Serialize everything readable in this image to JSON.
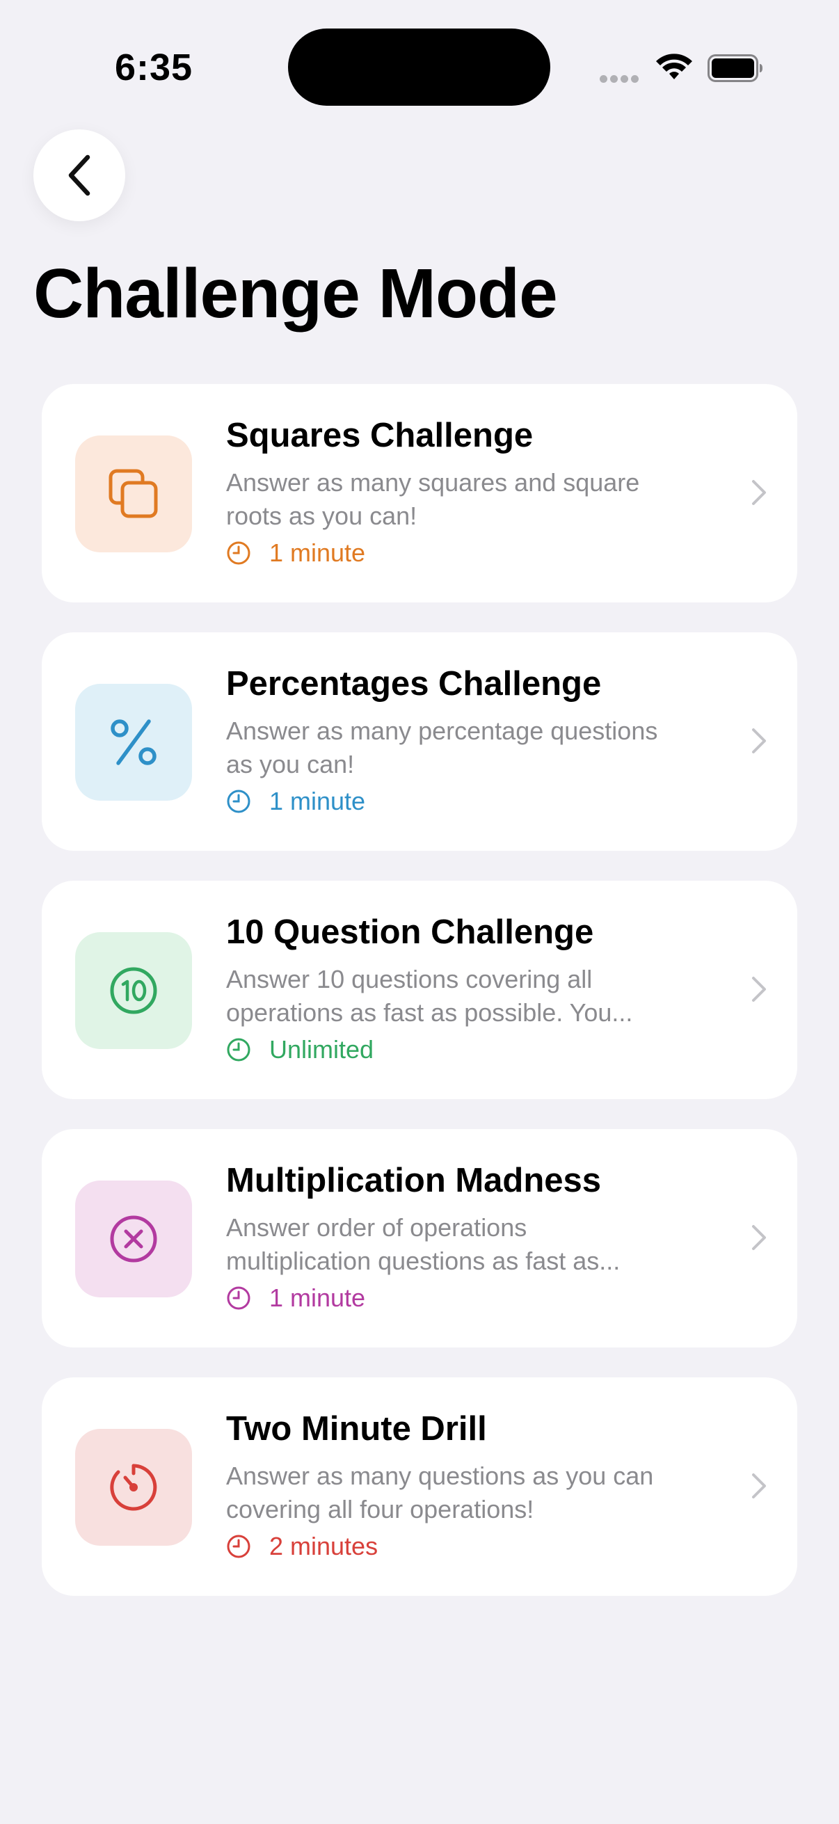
{
  "status": {
    "time": "6:35"
  },
  "nav": {
    "back_icon": "chevron-left-icon"
  },
  "page": {
    "title": "Challenge Mode"
  },
  "challenges": [
    {
      "title": "Squares Challenge",
      "description": "Answer as many squares and square roots as you can!",
      "duration": "1 minute",
      "icon": "squares-icon",
      "accent": "#e07a22",
      "tile_bg": "#fce8dc"
    },
    {
      "title": "Percentages Challenge",
      "description": "Answer as many percentage questions as you can!",
      "duration": "1 minute",
      "icon": "percent-icon",
      "accent": "#2e90c8",
      "tile_bg": "#dff0f8"
    },
    {
      "title": "10 Question Challenge",
      "description": "Answer 10 questions covering all operations as fast as possible. You...",
      "duration": "Unlimited",
      "icon": "number-ten-circle-icon",
      "accent": "#31a860",
      "tile_bg": "#e0f4e6"
    },
    {
      "title": "Multiplication Madness",
      "description": "Answer order of operations multiplication questions as fast as...",
      "duration": "1 minute",
      "icon": "multiply-circle-icon",
      "accent": "#b23aa0",
      "tile_bg": "#f4dff0"
    },
    {
      "title": "Two Minute Drill",
      "description": "Answer as many questions as you can covering all four operations!",
      "duration": "2 minutes",
      "icon": "timer-icon",
      "accent": "#d8403a",
      "tile_bg": "#f8e0df"
    }
  ],
  "colors": {
    "background": "#f2f1f6",
    "card": "#ffffff",
    "secondary_text": "#8a8a8e",
    "chevron": "#c4c4c8"
  }
}
